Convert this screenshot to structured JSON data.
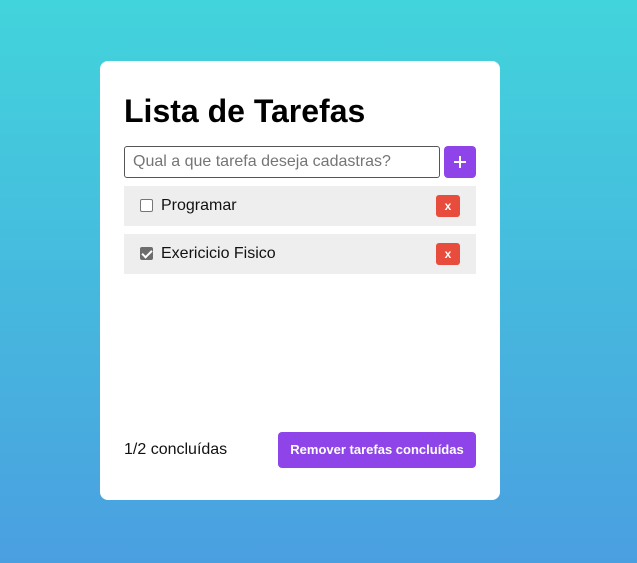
{
  "app": {
    "title": "Lista de Tarefas"
  },
  "new_task": {
    "placeholder": "Qual a que tarefa deseja cadastras?",
    "value": "",
    "add_label": "+"
  },
  "tasks": [
    {
      "label": "Programar",
      "done": false,
      "delete_label": "x"
    },
    {
      "label": "Exericicio Fisico",
      "done": true,
      "delete_label": "x"
    }
  ],
  "footer": {
    "count": "1/2 concluídas",
    "clear_label": "Remover tarefas concluídas"
  },
  "colors": {
    "accent": "#8e44e8",
    "danger": "#e74c3c",
    "background_top": "#42d4dc",
    "background_bottom": "#4a9fe0"
  }
}
